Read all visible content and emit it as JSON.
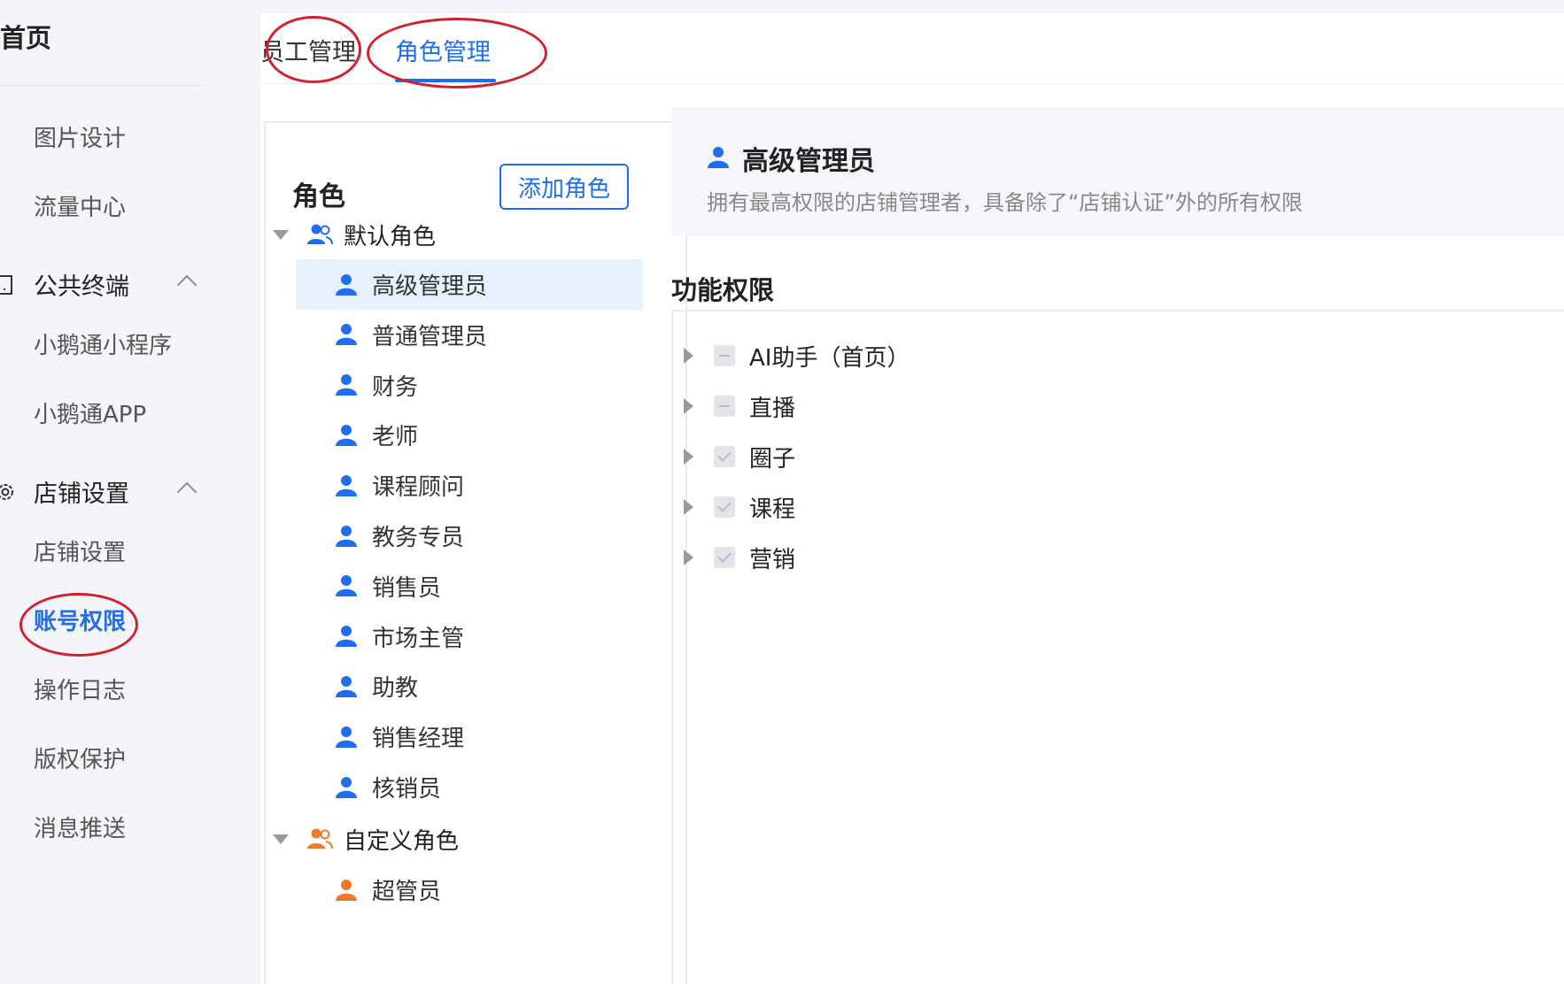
{
  "sidebar": {
    "home": "首页",
    "items": {
      "image_design": "图片设计",
      "traffic_center": "流量中心",
      "public_terminal": "公共终端",
      "mini_program": "小鹅通小程序",
      "app": "小鹅通APP",
      "shop_settings_group": "店铺设置",
      "shop_settings": "店铺设置",
      "account_permissions": "账号权限",
      "operation_log": "操作日志",
      "copyright": "版权保护",
      "message_push": "消息推送"
    }
  },
  "tabs": {
    "staff": "员工管理",
    "roles": "角色管理"
  },
  "roles": {
    "title": "角色",
    "add_button": "添加角色",
    "default_group": "默认角色",
    "default_roles": [
      "高级管理员",
      "普通管理员",
      "财务",
      "老师",
      "课程顾问",
      "教务专员",
      "销售员",
      "市场主管",
      "助教",
      "销售经理",
      "核销员"
    ],
    "custom_group": "自定义角色",
    "custom_roles": [
      "超管员"
    ]
  },
  "detail": {
    "name": "高级管理员",
    "description": "拥有最高权限的店铺管理者，具备除了“店铺认证”外的所有权限",
    "permissions_title": "功能权限",
    "permissions": [
      {
        "label": "AI助手（首页）",
        "state": "indeterminate"
      },
      {
        "label": "直播",
        "state": "indeterminate"
      },
      {
        "label": "圈子",
        "state": "checked"
      },
      {
        "label": "课程",
        "state": "checked"
      },
      {
        "label": "营销",
        "state": "checked"
      }
    ]
  },
  "colors": {
    "accent": "#1f6ef0",
    "custom_group_icon": "#f07a2a",
    "annotation": "#d4202c"
  }
}
